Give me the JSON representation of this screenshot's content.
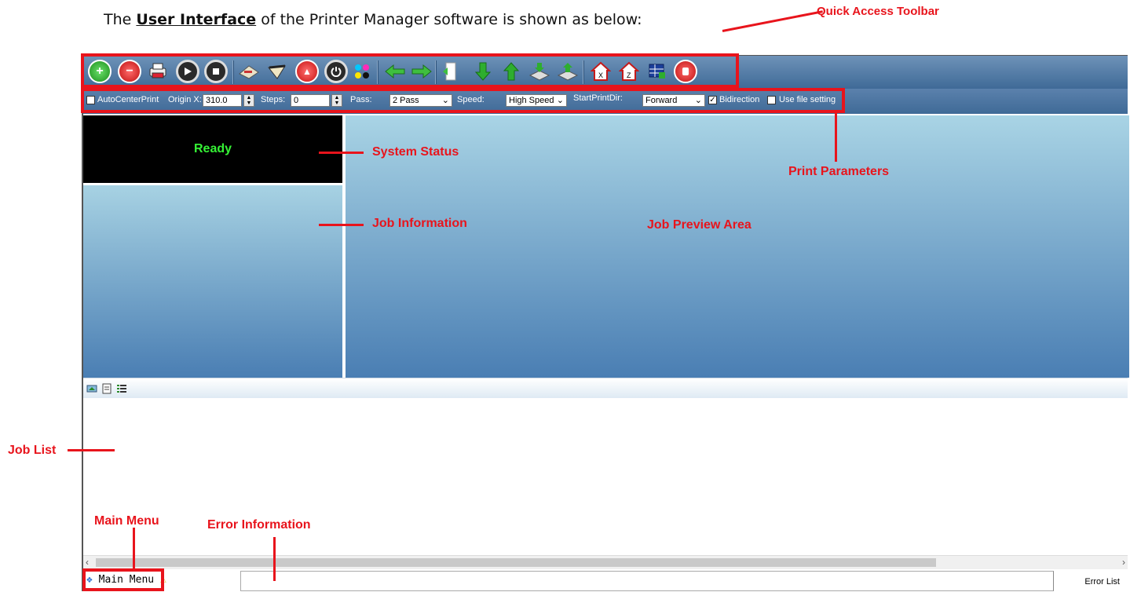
{
  "caption": {
    "prefix": "The ",
    "link": "User Interface",
    "suffix": " of the Printer Manager software is shown as below:"
  },
  "annotations": {
    "quick_access_toolbar": "Quick Access Toolbar",
    "print_parameters": "Print Parameters",
    "system_status": "System Status",
    "job_information": "Job Information",
    "job_preview_area": "Job Preview Area",
    "job_list": "Job List",
    "main_menu": "Main Menu",
    "error_information": "Error Information"
  },
  "toolbar": {
    "icons": [
      "add-icon",
      "remove-icon",
      "print-icon",
      "play-icon",
      "stop-icon",
      "clean-icon",
      "measure-icon",
      "alert-icon",
      "power-icon",
      "color-icon",
      "move-left-icon",
      "move-right-icon",
      "feed-icon",
      "down-icon",
      "up-icon",
      "media-down-icon",
      "media-up-icon",
      "home-x-icon",
      "home-z-icon",
      "grid-icon",
      "emergency-stop-icon"
    ]
  },
  "params": {
    "auto_center_label": "AutoCenterPrint",
    "origin_x_label": "Origin X:",
    "origin_x_value": "310.0",
    "steps_label": "Steps:",
    "steps_value": "0",
    "pass_label": "Pass:",
    "pass_value": "2 Pass",
    "speed_label": "Speed:",
    "speed_value": "High Speed",
    "start_dir_label": "StartPrintDir:",
    "start_dir_value": "Forward",
    "bidirection_label": "Bidirection",
    "bidirection_checked": true,
    "use_file_label": "Use file setting"
  },
  "status": {
    "text": "Ready",
    "color": "#35f235"
  },
  "bottom": {
    "main_menu": "Main Menu",
    "error_list": "Error List"
  },
  "colors": {
    "annotation": "#e8141c"
  }
}
